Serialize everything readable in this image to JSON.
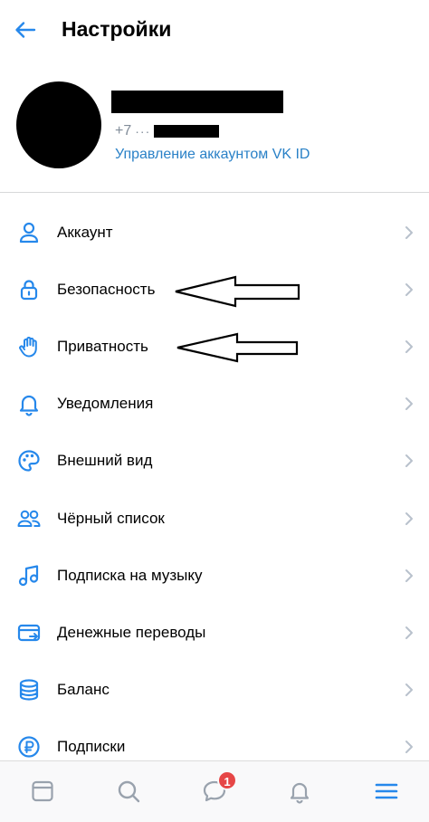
{
  "header": {
    "title": "Настройки",
    "back_icon": "arrow-left-icon"
  },
  "profile": {
    "phone_prefix": "+7",
    "phone_dots": "···",
    "vkid_link": "Управление аккаунтом VK ID"
  },
  "menu": {
    "items": [
      {
        "label": "Аккаунт",
        "icon": "user-icon"
      },
      {
        "label": "Безопасность",
        "icon": "lock-icon"
      },
      {
        "label": "Приватность",
        "icon": "hand-icon"
      },
      {
        "label": "Уведомления",
        "icon": "bell-icon"
      },
      {
        "label": "Внешний вид",
        "icon": "palette-icon"
      },
      {
        "label": "Чёрный список",
        "icon": "users-icon"
      },
      {
        "label": "Подписка на музыку",
        "icon": "music-note-icon"
      },
      {
        "label": "Денежные переводы",
        "icon": "money-transfer-icon"
      },
      {
        "label": "Баланс",
        "icon": "coins-stack-icon"
      },
      {
        "label": "Подписки",
        "icon": "ruble-icon"
      }
    ]
  },
  "tabbar": {
    "messages_badge": "1",
    "tabs": [
      "news-icon",
      "search-icon",
      "messages-icon",
      "notifications-icon",
      "menu-icon"
    ]
  },
  "colors": {
    "accent": "#2a81c7",
    "icon": "#2688eb",
    "secondary_text": "#818c99",
    "badge": "#e64646",
    "chevron": "#b8c1cc"
  }
}
